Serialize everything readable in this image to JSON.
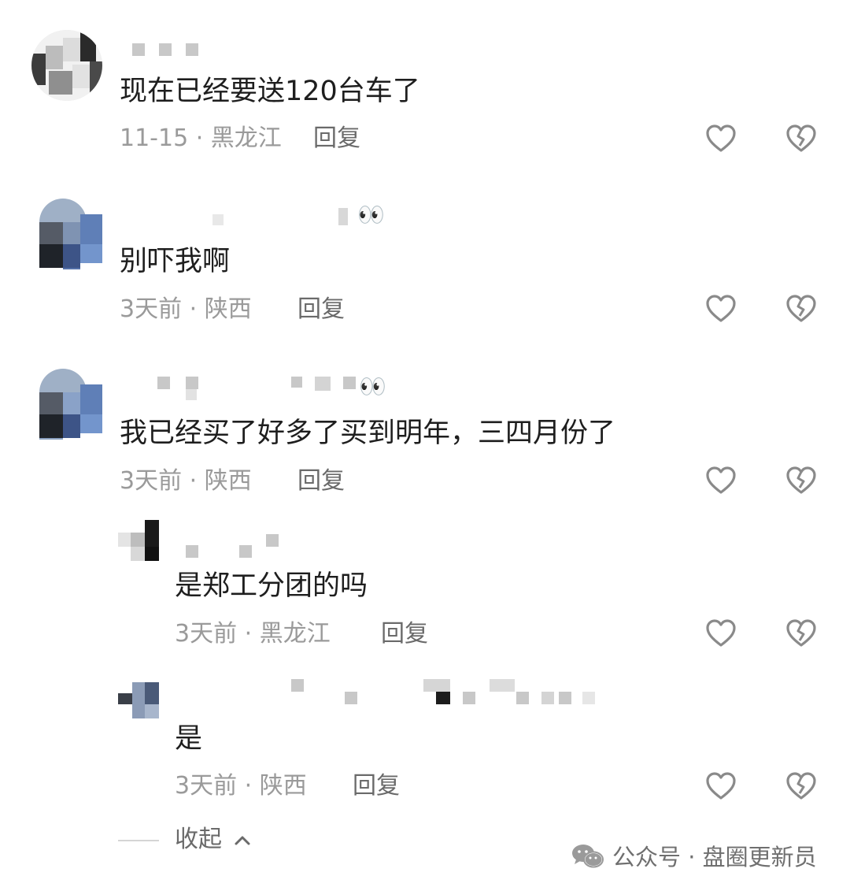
{
  "comments": [
    {
      "text": "现在已经要送120台车了",
      "meta": "11-15 · 黑龙江",
      "reply": "回复"
    },
    {
      "name_suffix": "👀",
      "text": "别吓我啊",
      "meta": "3天前 · 陕西",
      "reply": "回复"
    },
    {
      "name_suffix": "👀",
      "text": "我已经买了好多了买到明年，三四月份了",
      "meta": "3天前 · 陕西",
      "reply": "回复"
    },
    {
      "text": "是郑工分团的吗",
      "meta": "3天前 · 黑龙江",
      "reply": "回复"
    },
    {
      "text": "是",
      "meta": "3天前 · 陕西",
      "reply": "回复"
    }
  ],
  "icons": {
    "like": "heart-outline-icon",
    "dislike": "broken-heart-icon",
    "collapse": "chevron-up-icon",
    "watermark": "wechat-logo-icon"
  },
  "collapse_label": "收起",
  "watermark": "公众号 · 盘圈更新员",
  "colors": {
    "text": "#1e1e1e",
    "meta": "#9a9a9a",
    "reply": "#6a6a6a",
    "icon": "#8a8a8a"
  }
}
